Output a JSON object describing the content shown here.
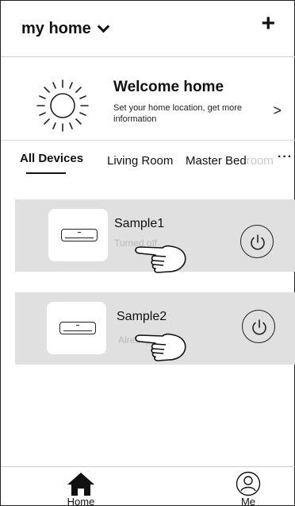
{
  "header": {
    "title": "my home",
    "add_label": "+"
  },
  "welcome": {
    "title": "Welcome home",
    "subtitle": "Set your home location, get more information",
    "arrow": ">"
  },
  "tabs": {
    "items": [
      {
        "label": "All Devices",
        "active": true
      },
      {
        "label": "Living Room",
        "active": false
      },
      {
        "label_visible": "Master Bed",
        "label_faded": "room",
        "active": false
      }
    ],
    "more": "···"
  },
  "devices": [
    {
      "name": "Sample1",
      "status": "Turned off"
    },
    {
      "name": "Sample2",
      "status": "Already On"
    }
  ],
  "bottom_nav": {
    "home_label": "Home",
    "me_label": "Me"
  },
  "colors": {
    "card_bg": "#e0e0e0",
    "status_text": "#b9b9b9",
    "divider": "#cfcfcf"
  }
}
